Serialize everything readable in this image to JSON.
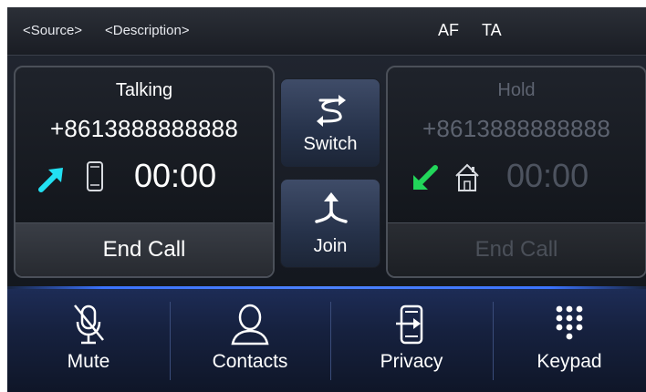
{
  "header": {
    "source": "<Source>",
    "description": "<Description>",
    "af": "AF",
    "ta": "TA"
  },
  "calls": {
    "active": {
      "status": "Talking",
      "number": "+8613888888888",
      "duration": "00:00",
      "direction_icon": "outgoing-arrow-icon",
      "device_icon": "mobile-phone-icon",
      "end_label": "End Call"
    },
    "held": {
      "status": "Hold",
      "number": "+8613888888888",
      "duration": "00:00",
      "direction_icon": "incoming-arrow-icon",
      "device_icon": "home-icon",
      "end_label": "End Call"
    }
  },
  "actions": {
    "switch_label": "Switch",
    "join_label": "Join"
  },
  "bottom_bar": [
    {
      "key": "mute",
      "label": "Mute",
      "icon": "mic-muted-icon"
    },
    {
      "key": "contacts",
      "label": "Contacts",
      "icon": "contact-person-icon"
    },
    {
      "key": "privacy",
      "label": "Privacy",
      "icon": "privacy-transfer-icon"
    },
    {
      "key": "keypad",
      "label": "Keypad",
      "icon": "keypad-icon"
    }
  ],
  "colors": {
    "outgoing_arrow": "#22e0f2",
    "incoming_arrow": "#22d65a",
    "accent_line": "#3b73ff"
  }
}
